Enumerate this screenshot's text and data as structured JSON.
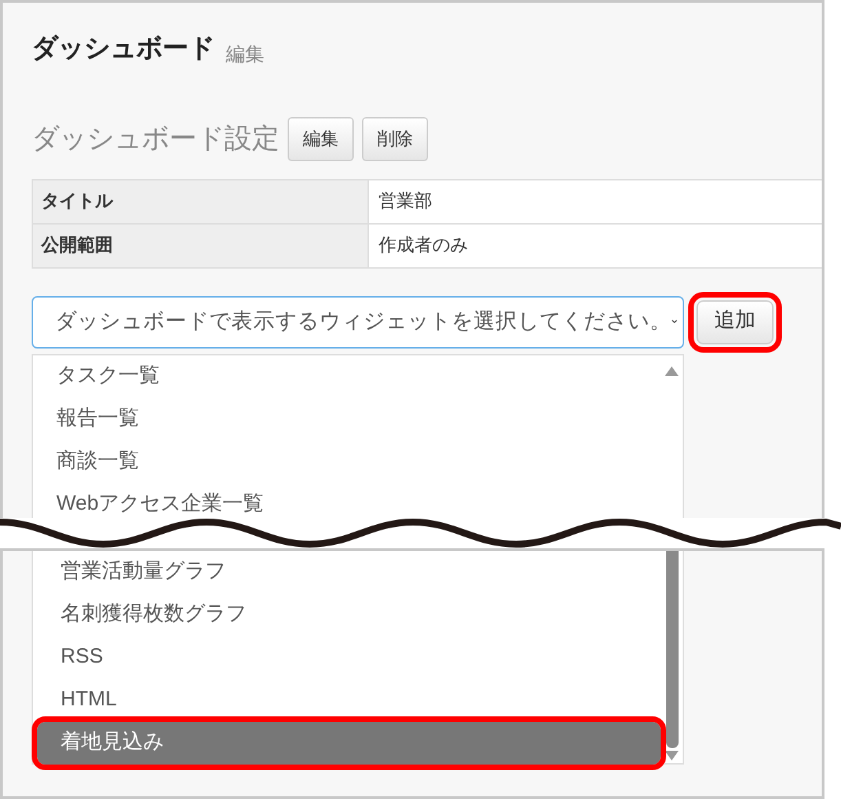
{
  "header": {
    "title": "ダッシュボード",
    "subtitle": "編集"
  },
  "settings": {
    "heading": "ダッシュボード設定",
    "buttons": [
      "編集",
      "削除"
    ],
    "rows": [
      {
        "label": "タイトル",
        "value": "営業部"
      },
      {
        "label": "公開範囲",
        "value": "作成者のみ"
      }
    ]
  },
  "widget_select": {
    "value": "ダッシュボードで表示するウィジェットを選択してください。",
    "add_button": {
      "label": "追加",
      "highlighted": true
    }
  },
  "list_top": [
    {
      "label": "タスク一覧",
      "selected": false,
      "highlighted": false
    },
    {
      "label": "報告一覧",
      "selected": false,
      "highlighted": false
    },
    {
      "label": "商談一覧",
      "selected": false,
      "highlighted": false
    },
    {
      "label": "Webアクセス企業一覧",
      "selected": false,
      "highlighted": false
    }
  ],
  "list_bottom": [
    {
      "label": "営業活動量グラフ",
      "selected": false,
      "highlighted": false
    },
    {
      "label": "名刺獲得枚数グラフ",
      "selected": false,
      "highlighted": false
    },
    {
      "label": "RSS",
      "selected": false,
      "highlighted": false
    },
    {
      "label": "HTML",
      "selected": false,
      "highlighted": false
    },
    {
      "label": "着地見込み",
      "selected": true,
      "highlighted": true
    }
  ]
}
